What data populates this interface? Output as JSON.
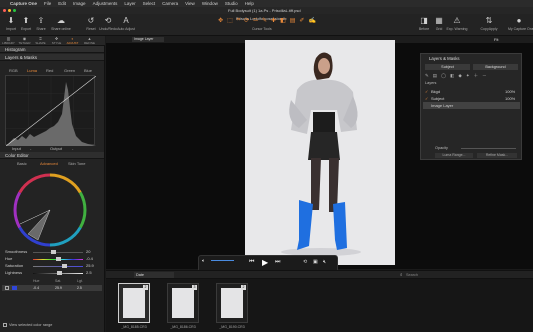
{
  "menubar": {
    "apple": "",
    "app": "Capture One",
    "items": [
      "File",
      "Edit",
      "Image",
      "Adjustments",
      "Layer",
      "Select",
      "Camera",
      "View",
      "Window",
      "Studio",
      "Help"
    ]
  },
  "window": {
    "tab_title": "Full Bodysuit (1) 1a.Ps - PriscillaL.tiff.psd",
    "doc_title": "Priscila Lodulfo.cosessiondb"
  },
  "toolbar": {
    "left": [
      {
        "label": "Import",
        "icon": "import-icon"
      },
      {
        "label": "Export",
        "icon": "export-icon"
      },
      {
        "label": "Share",
        "icon": "share-icon"
      },
      {
        "label": "Share online",
        "icon": "cloud-icon"
      }
    ],
    "mid": [
      {
        "label": "Reset",
        "icon": "reset-icon"
      },
      {
        "label": "Undo/Redo",
        "icon": "undo-icon"
      },
      {
        "label": "Auto Adjust",
        "icon": "auto-adjust-icon"
      }
    ],
    "cursor_tools": "Cursor Tools",
    "right": [
      {
        "label": "Before",
        "icon": "before-icon"
      },
      {
        "label": "Grid",
        "icon": "grid-icon"
      },
      {
        "label": "Exp. Warning",
        "icon": "warning-icon"
      },
      {
        "label": "CopyApply",
        "icon": "copy-icon"
      },
      {
        "label": "My Capture One",
        "icon": "account-icon"
      }
    ]
  },
  "tooltabs": [
    {
      "label": "LIBRARY",
      "icon": "library-icon"
    },
    {
      "label": "TETHER",
      "icon": "camera-icon"
    },
    {
      "label": "SHAPE",
      "icon": "crop-icon"
    },
    {
      "label": "STYLE",
      "icon": "style-icon"
    },
    {
      "label": "ADJUST",
      "icon": "adjust-icon",
      "active": true
    },
    {
      "label": "REFINE",
      "icon": "refine-icon"
    }
  ],
  "histogram": {
    "title": "Histogram"
  },
  "layers_section": {
    "title": "Layers & Masks"
  },
  "curve": {
    "tabs": [
      "RGB",
      "Luma",
      "Red",
      "Green",
      "Blue"
    ],
    "active": "Luma",
    "input_label": "Input",
    "input_value": "-",
    "output_label": "Output",
    "output_value": "-"
  },
  "color_editor": {
    "title": "Color Editor",
    "tabs": [
      "Basic",
      "Advanced",
      "Skin Tone"
    ],
    "active": "Advanced",
    "sliders": [
      {
        "name": "Smoothness",
        "value": "20",
        "level": 0.4
      },
      {
        "name": "Hue",
        "value": "-0.4",
        "level": 0.5
      },
      {
        "name": "Saturation",
        "value": "25.9",
        "level": 0.62
      },
      {
        "name": "Lightness",
        "value": "2.5",
        "level": 0.53
      }
    ],
    "list_headers": [
      "Hue",
      "Sat.",
      "Lgt."
    ],
    "list_row": [
      "-0.4",
      "25.9",
      "2.5"
    ],
    "footer": "View selected color range"
  },
  "viewer": {
    "layer_dropdown": "Image Layer",
    "fit": "Fit",
    "zoom_sep": "|"
  },
  "layers_panel": {
    "title": "Layers & Masks",
    "subject_btn": "Subject",
    "background_btn": "Background",
    "layers_label": "Layers",
    "rows": [
      {
        "name": "Bkgd",
        "value": "100%"
      },
      {
        "name": "Subject",
        "value": "100%"
      },
      {
        "name": "Image Layer",
        "value": ""
      }
    ],
    "opacity_label": "Opacity",
    "buttons": [
      "Luma Range...",
      "Refine Mask..."
    ]
  },
  "playback": {
    "time_left": "0:00:73",
    "time_right": "6:63"
  },
  "browser": {
    "tab": "Date",
    "search_placeholder": "Search",
    "thumbs": [
      {
        "name": "_MG_8185.CR3",
        "num": "2",
        "selected": true
      },
      {
        "name": "_MG_8186.CR3",
        "num": "3",
        "selected": false
      },
      {
        "name": "_MG_8190.CR3",
        "num": "2",
        "selected": false
      }
    ]
  },
  "colors": {
    "accent": "#e8893a",
    "panel": "#232323",
    "viewer": "#0c0c0c",
    "boot": "#1f6fe0"
  }
}
